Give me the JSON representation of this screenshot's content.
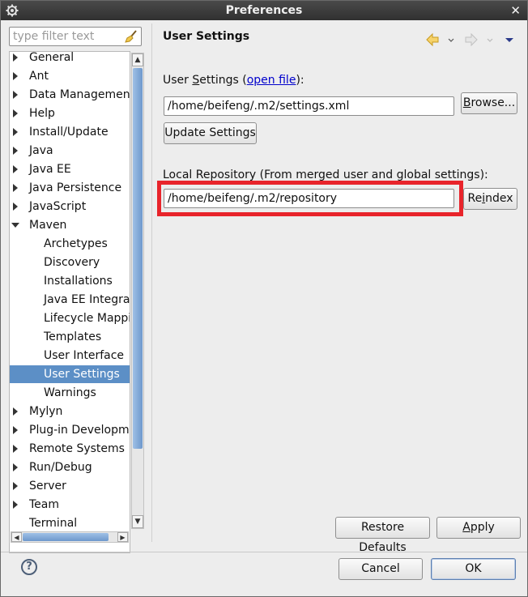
{
  "window": {
    "title": "Preferences"
  },
  "filter": {
    "placeholder": "type filter text"
  },
  "tree": [
    {
      "label": "General",
      "state": "collapsed",
      "level": 0
    },
    {
      "label": "Ant",
      "state": "collapsed",
      "level": 0
    },
    {
      "label": "Data Management",
      "state": "collapsed",
      "level": 0
    },
    {
      "label": "Help",
      "state": "collapsed",
      "level": 0
    },
    {
      "label": "Install/Update",
      "state": "collapsed",
      "level": 0
    },
    {
      "label": "Java",
      "state": "collapsed",
      "level": 0
    },
    {
      "label": "Java EE",
      "state": "collapsed",
      "level": 0
    },
    {
      "label": "Java Persistence",
      "state": "collapsed",
      "level": 0
    },
    {
      "label": "JavaScript",
      "state": "collapsed",
      "level": 0
    },
    {
      "label": "Maven",
      "state": "expanded",
      "level": 0
    },
    {
      "label": "Archetypes",
      "state": "leaf",
      "level": 1
    },
    {
      "label": "Discovery",
      "state": "leaf",
      "level": 1
    },
    {
      "label": "Installations",
      "state": "leaf",
      "level": 1
    },
    {
      "label": "Java EE Integrati",
      "state": "leaf",
      "level": 1
    },
    {
      "label": "Lifecycle Mappir",
      "state": "leaf",
      "level": 1
    },
    {
      "label": "Templates",
      "state": "leaf",
      "level": 1
    },
    {
      "label": "User Interface",
      "state": "leaf",
      "level": 1
    },
    {
      "label": "User Settings",
      "state": "leaf",
      "level": 1,
      "selected": true
    },
    {
      "label": "Warnings",
      "state": "leaf",
      "level": 1
    },
    {
      "label": "Mylyn",
      "state": "collapsed",
      "level": 0
    },
    {
      "label": "Plug-in Developme",
      "state": "collapsed",
      "level": 0
    },
    {
      "label": "Remote Systems",
      "state": "collapsed",
      "level": 0
    },
    {
      "label": "Run/Debug",
      "state": "collapsed",
      "level": 0
    },
    {
      "label": "Server",
      "state": "collapsed",
      "level": 0
    },
    {
      "label": "Team",
      "state": "collapsed",
      "level": 0
    },
    {
      "label": "Terminal",
      "state": "leaf",
      "level": 0
    }
  ],
  "page": {
    "title": "User Settings",
    "user_settings_label_pre": "User ",
    "user_settings_label_mnemonic": "S",
    "user_settings_label_post": "ettings (",
    "open_file_link": "open file",
    "user_settings_label_end": "):",
    "user_settings_value": "/home/beifeng/.m2/settings.xml",
    "browse_pre": "",
    "browse_mnemonic": "B",
    "browse_post": "rowse...",
    "update_settings_label": "Update Settings",
    "local_repo_label": "Local Repository (From merged user and global settings):",
    "local_repo_value": "/home/beifeng/.m2/repository",
    "reindex_pre": "Re",
    "reindex_mnemonic": "i",
    "reindex_post": "ndex",
    "restore_pre": "Restore ",
    "restore_mnemonic": "D",
    "restore_post": "efaults",
    "apply_mnemonic": "A",
    "apply_post": "pply"
  },
  "footer": {
    "cancel_label": "Cancel",
    "ok_label": "OK"
  },
  "colors": {
    "highlight": "#e8242b",
    "selection": "#5c8fc6",
    "link": "#0000cc"
  }
}
